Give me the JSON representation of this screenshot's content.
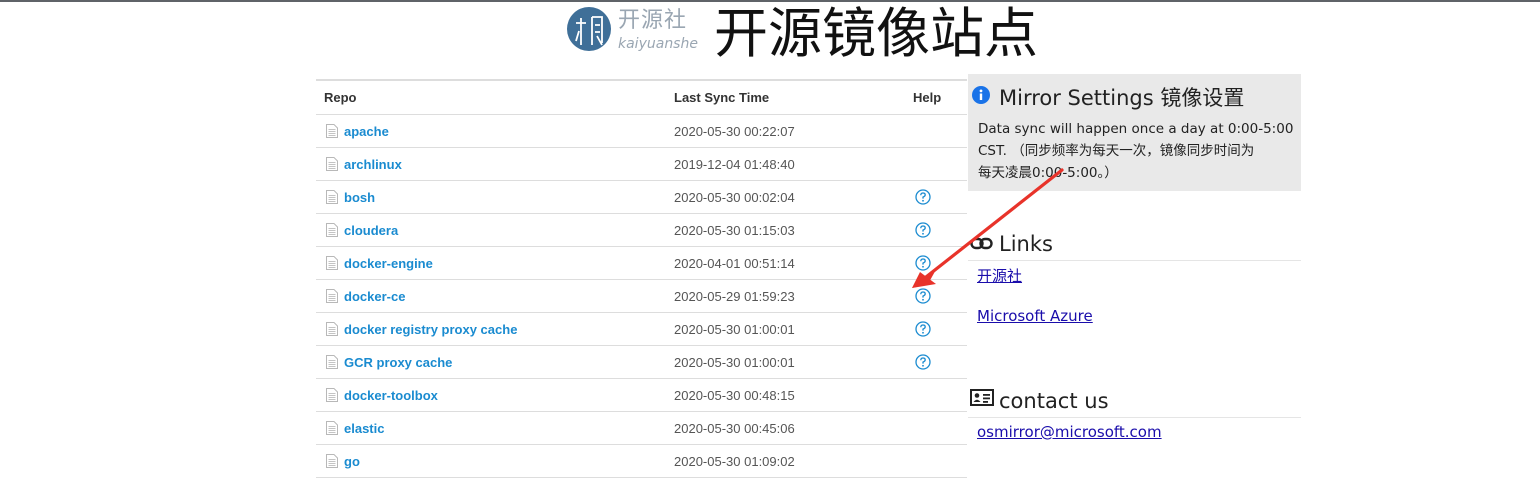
{
  "header": {
    "logo_cn": "开源社",
    "logo_en": "kaiyuanshe",
    "site_title": "开源镜像站点"
  },
  "table": {
    "columns": [
      "Repo",
      "Last Sync Time",
      "Help"
    ],
    "rows": [
      {
        "repo": "apache",
        "time": "2020-05-30 00:22:07",
        "help": false
      },
      {
        "repo": "archlinux",
        "time": "2019-12-04 01:48:40",
        "help": false
      },
      {
        "repo": "bosh",
        "time": "2020-05-30 00:02:04",
        "help": true
      },
      {
        "repo": "cloudera",
        "time": "2020-05-30 01:15:03",
        "help": true
      },
      {
        "repo": "docker-engine",
        "time": "2020-04-01 00:51:14",
        "help": true
      },
      {
        "repo": "docker-ce",
        "time": "2020-05-29 01:59:23",
        "help": true
      },
      {
        "repo": "docker registry proxy cache",
        "time": "2020-05-30 01:00:01",
        "help": true
      },
      {
        "repo": "GCR proxy cache",
        "time": "2020-05-30 01:00:01",
        "help": true
      },
      {
        "repo": "docker-toolbox",
        "time": "2020-05-30 00:48:15",
        "help": false
      },
      {
        "repo": "elastic",
        "time": "2020-05-30 00:45:06",
        "help": false
      },
      {
        "repo": "go",
        "time": "2020-05-30 01:09:02",
        "help": false
      }
    ]
  },
  "settings": {
    "title": "Mirror Settings 镜像设置",
    "line1": "Data sync will happen once a day at 0:00-5:00",
    "line2": "CST. （同步频率为每天一次，镜像同步时间为",
    "line3": "每天凌晨0:00-5:00。）"
  },
  "links": {
    "title": "Links",
    "items": [
      "开源社",
      "Microsoft Azure"
    ]
  },
  "contact": {
    "title": "contact us",
    "email": "osmirror@microsoft.com"
  },
  "colors": {
    "link": "#1a8bd0",
    "panel_link": "#1a0dab",
    "settings_bg": "#e9e9e9",
    "info": "#1a73e8",
    "arrow": "#e8332a"
  },
  "icons": {
    "logo": "kaiyuanshe-logo",
    "file": "file-icon",
    "help": "question-circle-icon",
    "info": "info-circle-icon",
    "links": "link-icon",
    "contact": "address-card-icon"
  }
}
